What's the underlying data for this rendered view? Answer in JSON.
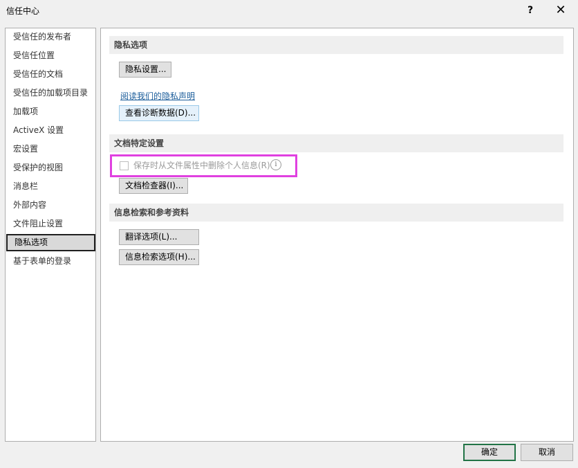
{
  "window": {
    "title": "信任中心",
    "help_label": "?",
    "close_label": "✕"
  },
  "nav": {
    "items": [
      {
        "label": "受信任的发布者"
      },
      {
        "label": "受信任位置"
      },
      {
        "label": "受信任的文档"
      },
      {
        "label": "受信任的加载项目录"
      },
      {
        "label": "加载项"
      },
      {
        "label": "ActiveX 设置"
      },
      {
        "label": "宏设置"
      },
      {
        "label": "受保护的视图"
      },
      {
        "label": "消息栏"
      },
      {
        "label": "外部内容"
      },
      {
        "label": "文件阻止设置"
      },
      {
        "label": "隐私选项"
      },
      {
        "label": "基于表单的登录"
      }
    ],
    "selected": "隐私选项"
  },
  "privacy": {
    "header": "隐私选项",
    "privacy_settings_button": "隐私设置...",
    "read_statement_link": "阅读我们的隐私声明",
    "view_diagnostics_button": "查看诊断数据(D)..."
  },
  "document": {
    "header": "文档特定设置",
    "remove_personal_info_label": "保存时从文件属性中删除个人信息(R)",
    "remove_personal_info_checked": false,
    "info_icon": "i",
    "document_inspector_button": "文档检查器(I)..."
  },
  "research": {
    "header": "信息检索和参考资料",
    "translation_options_button": "翻译选项(L)...",
    "research_options_button": "信息检索选项(H)..."
  },
  "footer": {
    "ok_label": "确定",
    "cancel_label": "取消"
  },
  "colors": {
    "highlight": "#e040e0",
    "ok_border": "#217346",
    "link": "#1a5c9a"
  }
}
